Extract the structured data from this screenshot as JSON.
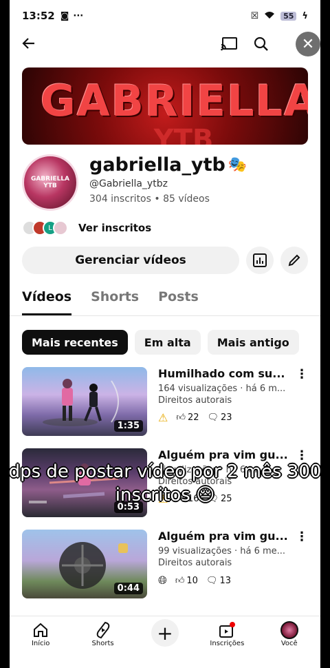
{
  "status": {
    "time": "13:52",
    "battery": "55"
  },
  "channel": {
    "banner_text": "GABRIELLA",
    "banner_text2": "YTB",
    "avatar_text": "GABRIELLA YTB",
    "name": "gabriella_ytb",
    "name_emoji": "🎭",
    "handle": "@Gabriella_ytbz",
    "stats": "304 inscritos • 85 vídeos",
    "view_subs_label": "Ver inscritos",
    "manage_label": "Gerenciar vídeos"
  },
  "tabs": [
    {
      "label": "Vídeos"
    },
    {
      "label": "Shorts"
    },
    {
      "label": "Posts"
    }
  ],
  "chips": [
    {
      "label": "Mais recentes"
    },
    {
      "label": "Em alta"
    },
    {
      "label": "Mais antigo"
    }
  ],
  "videos": [
    {
      "title": "Humilhado com su...",
      "meta": "164 visualizações · há 6 m...",
      "rights": "Direitos autorais",
      "likes": "22",
      "comments": "23",
      "duration": "1:35"
    },
    {
      "title": "Alguém pra vim gu...",
      "meta": "visualizações · há 6 m...",
      "rights": "Direitos autorais",
      "likes": "16",
      "comments": "25",
      "duration": "0:53"
    },
    {
      "title": "Alguém pra vim gu...",
      "meta": "99 visualizações · há 6 me...",
      "rights": "Direitos autorais",
      "likes": "10",
      "comments": "13",
      "duration": "0:44"
    }
  ],
  "overlay_caption": "dps de postar vídeo por 2 mês 300 inscritos 😔",
  "nav": [
    {
      "label": "Início"
    },
    {
      "label": "Shorts"
    },
    {
      "label": ""
    },
    {
      "label": "Inscrições"
    },
    {
      "label": "Você"
    }
  ]
}
